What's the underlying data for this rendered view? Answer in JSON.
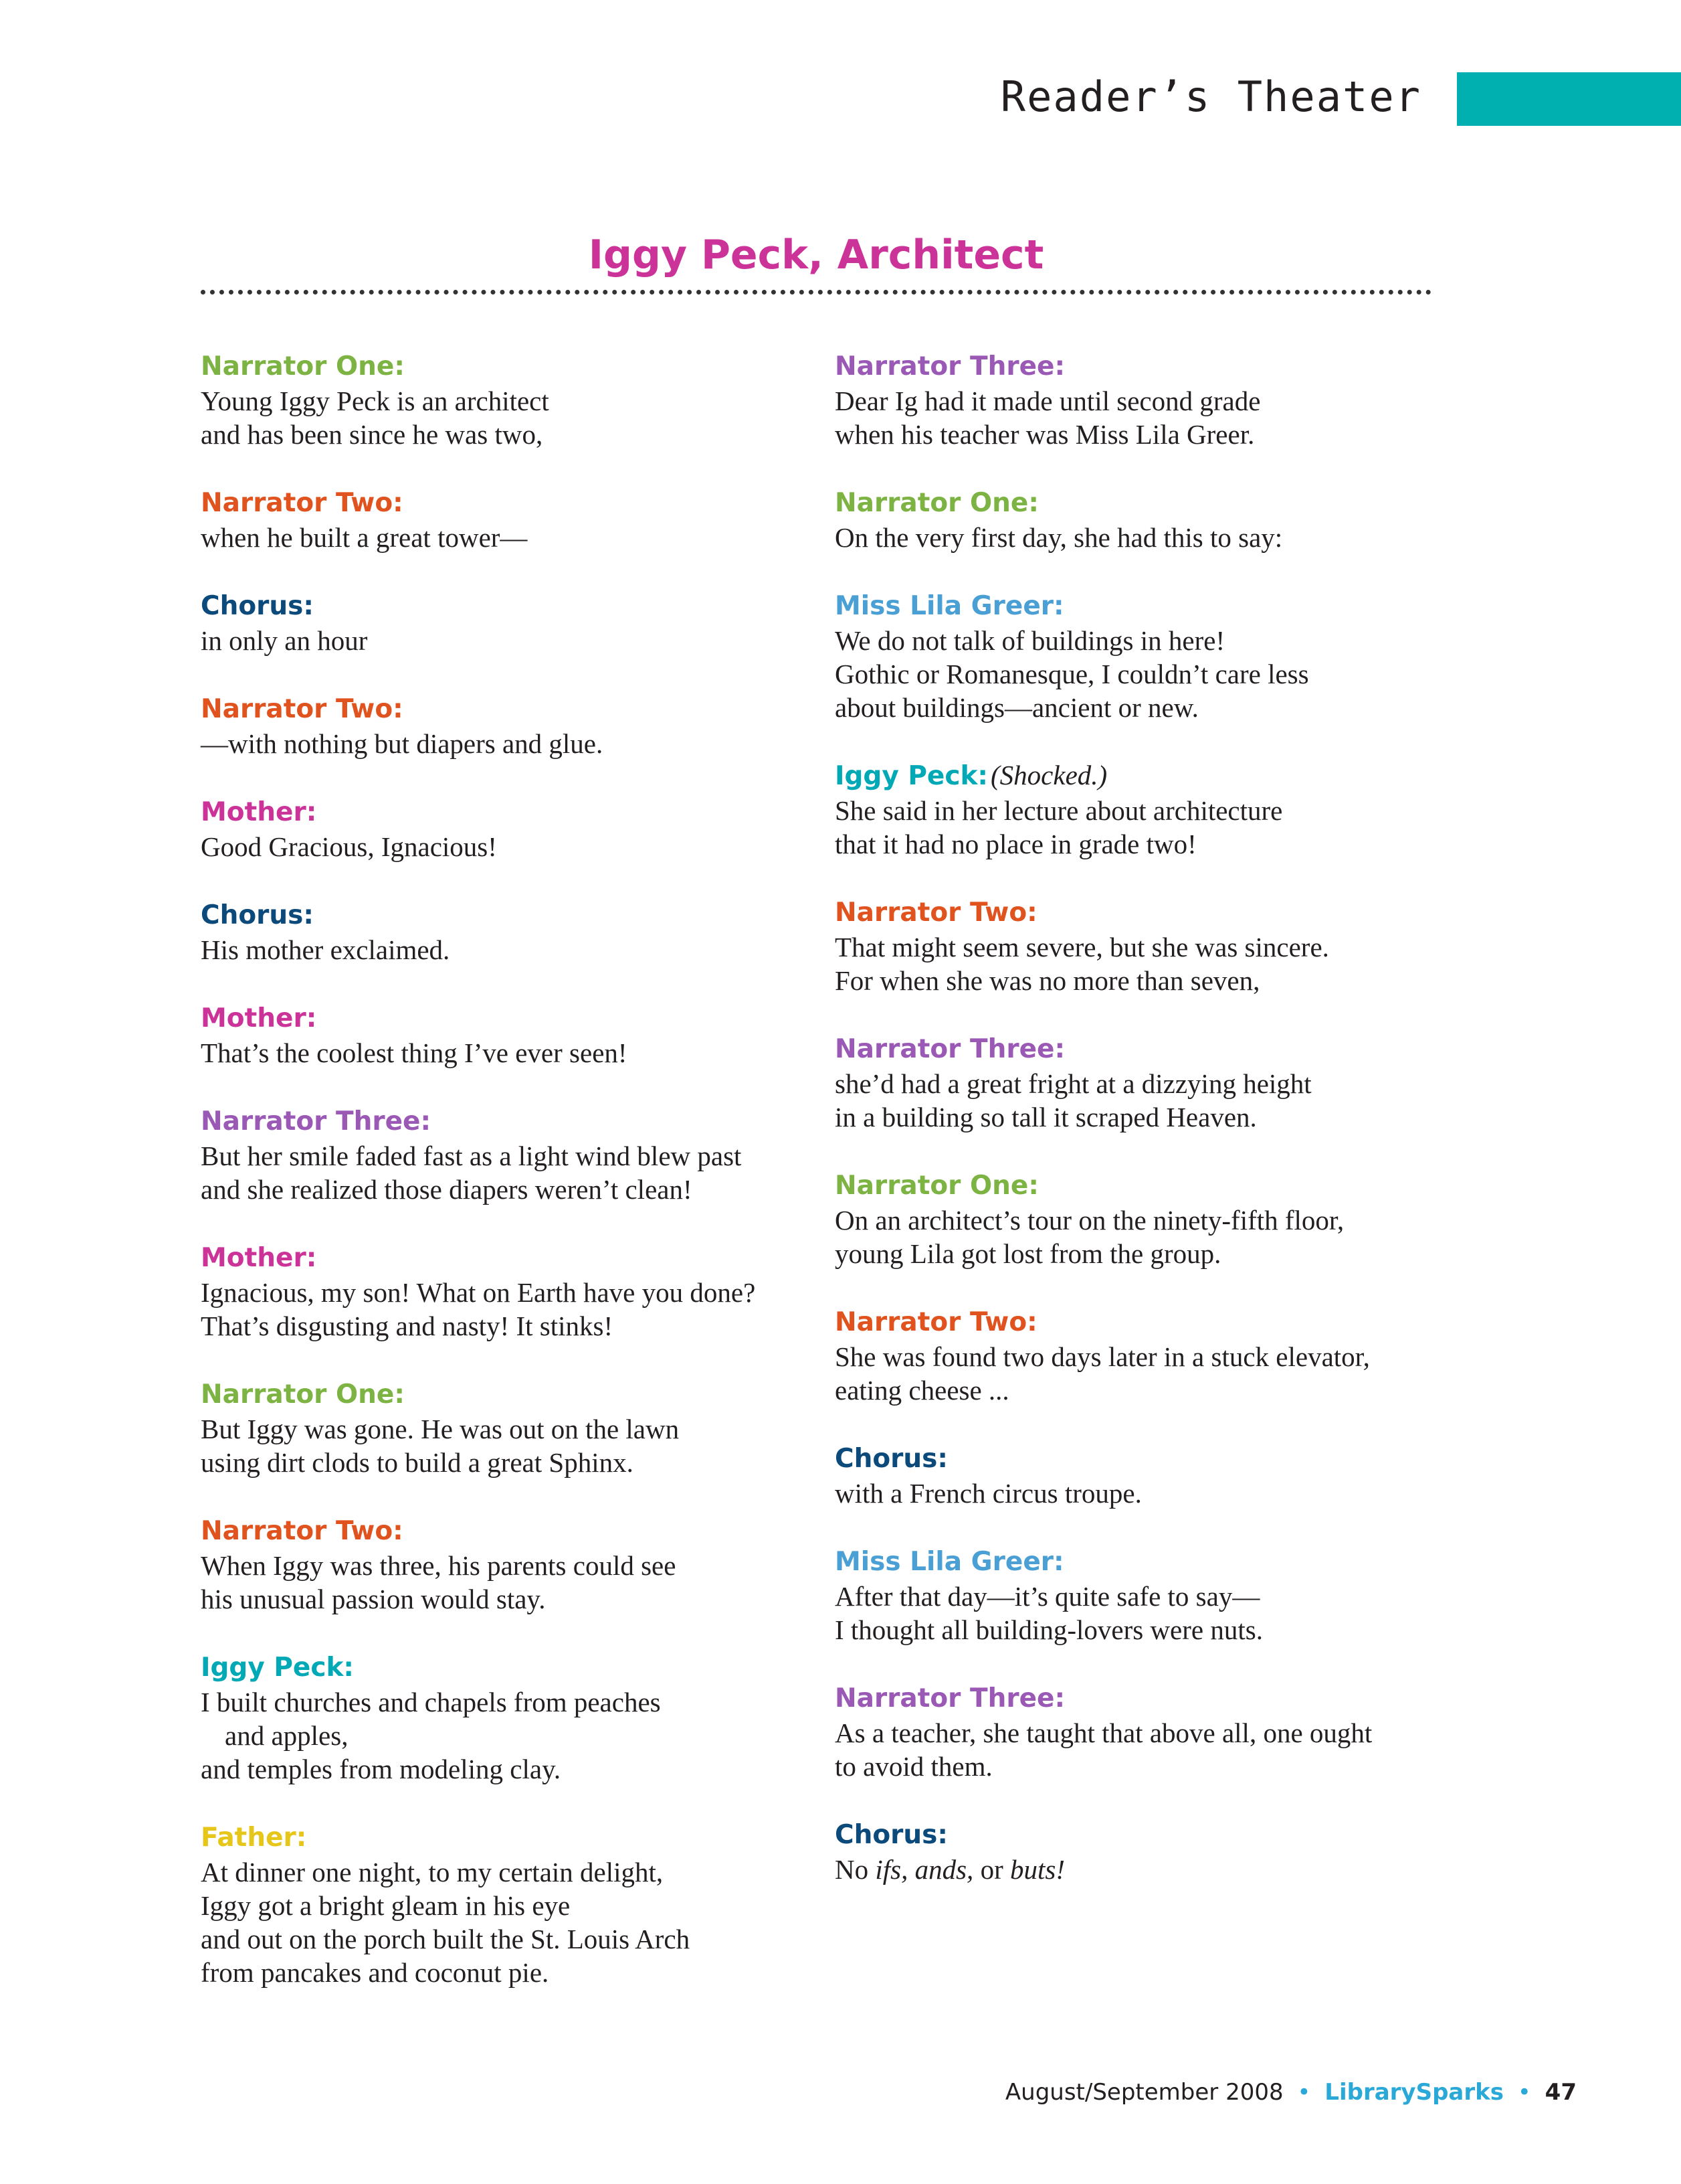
{
  "header": {
    "section": "Reader’s Theater"
  },
  "title": "Iggy Peck, Architect",
  "colors": {
    "accent_bar": "#00b0b0",
    "title": "#cc3399",
    "narrator_one": "#7cb342",
    "narrator_two": "#e0531f",
    "narrator_three": "#9b59b6",
    "chorus": "#0b4a7a",
    "mother": "#cc3399",
    "father": "#e6c619",
    "iggy_peck": "#00a9b5",
    "miss_lila_greer": "#4a9fd4",
    "footer_brand": "#2aa8d8"
  },
  "left_column": [
    {
      "speaker": "Narrator One:",
      "role": "narrator_one",
      "lines": [
        "Young Iggy Peck is an architect",
        "and has been since he was two,"
      ]
    },
    {
      "speaker": "Narrator Two:",
      "role": "narrator_two",
      "lines": [
        "when he built a great tower—"
      ]
    },
    {
      "speaker": "Chorus:",
      "role": "chorus",
      "lines": [
        "in only an hour"
      ]
    },
    {
      "speaker": "Narrator Two:",
      "role": "narrator_two",
      "lines": [
        "—with nothing but diapers and glue."
      ]
    },
    {
      "speaker": "Mother:",
      "role": "mother",
      "lines": [
        "Good Gracious, Ignacious!"
      ]
    },
    {
      "speaker": "Chorus:",
      "role": "chorus",
      "lines": [
        "His mother exclaimed."
      ]
    },
    {
      "speaker": "Mother:",
      "role": "mother",
      "lines": [
        "That’s the coolest thing I’ve ever seen!"
      ]
    },
    {
      "speaker": "Narrator Three:",
      "role": "narrator_three",
      "lines": [
        "But her smile faded fast as a light wind blew past",
        "and she realized those diapers weren’t clean!"
      ]
    },
    {
      "speaker": "Mother:",
      "role": "mother",
      "lines": [
        "Ignacious, my son!  What on Earth have you done?",
        "That’s disgusting and nasty! It stinks!"
      ]
    },
    {
      "speaker": "Narrator One:",
      "role": "narrator_one",
      "lines": [
        "But Iggy was gone. He was out on the lawn",
        "using dirt clods to build a great Sphinx."
      ]
    },
    {
      "speaker": "Narrator Two:",
      "role": "narrator_two",
      "lines": [
        "When Iggy was three, his parents could see",
        "his unusual passion would stay."
      ]
    },
    {
      "speaker": "Iggy Peck:",
      "role": "iggy_peck",
      "lines": [
        "I built churches and chapels from peaches",
        "and apples,",
        "and temples from modeling clay."
      ]
    },
    {
      "speaker": "Father:",
      "role": "father",
      "lines": [
        "At dinner one night, to my certain delight,",
        "Iggy got a bright gleam in his eye",
        "and out on the porch built the St. Louis Arch",
        "from pancakes and coconut pie."
      ]
    }
  ],
  "right_column": [
    {
      "speaker": "Narrator Three:",
      "role": "narrator_three",
      "lines": [
        "Dear Ig had it made until second grade",
        "when his teacher was Miss Lila Greer."
      ]
    },
    {
      "speaker": "Narrator One:",
      "role": "narrator_one",
      "lines": [
        "On the very first day, she had this to say:"
      ]
    },
    {
      "speaker": "Miss Lila Greer:",
      "role": "miss_lila_greer",
      "lines": [
        "We do not talk of buildings in here!",
        "Gothic or Romanesque, I couldn’t care less",
        "about buildings—ancient or new."
      ]
    },
    {
      "speaker": "Iggy Peck:",
      "role": "iggy_peck",
      "direction": "(Shocked.)",
      "lines": [
        "She said in her lecture about architecture",
        "that it had no place in grade two!"
      ]
    },
    {
      "speaker": "Narrator Two:",
      "role": "narrator_two",
      "lines": [
        "That might seem severe, but she was sincere.",
        "For when she was no more than seven,"
      ]
    },
    {
      "speaker": "Narrator Three:",
      "role": "narrator_three",
      "lines": [
        "she’d had a great fright at a dizzying height",
        "in a building so tall it scraped Heaven."
      ]
    },
    {
      "speaker": "Narrator One:",
      "role": "narrator_one",
      "lines": [
        "On an architect’s tour on the ninety-fifth floor,",
        "young Lila got lost from the group."
      ]
    },
    {
      "speaker": "Narrator Two:",
      "role": "narrator_two",
      "lines": [
        "She was found two days later in a stuck elevator,",
        "eating cheese ..."
      ]
    },
    {
      "speaker": "Chorus:",
      "role": "chorus",
      "lines": [
        "with a French circus troupe."
      ]
    },
    {
      "speaker": "Miss Lila Greer:",
      "role": "miss_lila_greer",
      "lines": [
        "After that day—it’s quite safe to say—",
        "I thought all building-lovers were nuts."
      ]
    },
    {
      "speaker": "Narrator Three:",
      "role": "narrator_three",
      "lines": [
        "As a teacher, she taught that above all, one ought",
        "to avoid them."
      ]
    },
    {
      "speaker": "Chorus:",
      "role": "chorus",
      "lines": [
        "No ifs, ands, or buts!"
      ]
    }
  ],
  "footer": {
    "issue": "August/September 2008",
    "separator": "•",
    "publication": "LibrarySparks",
    "page": "47"
  }
}
